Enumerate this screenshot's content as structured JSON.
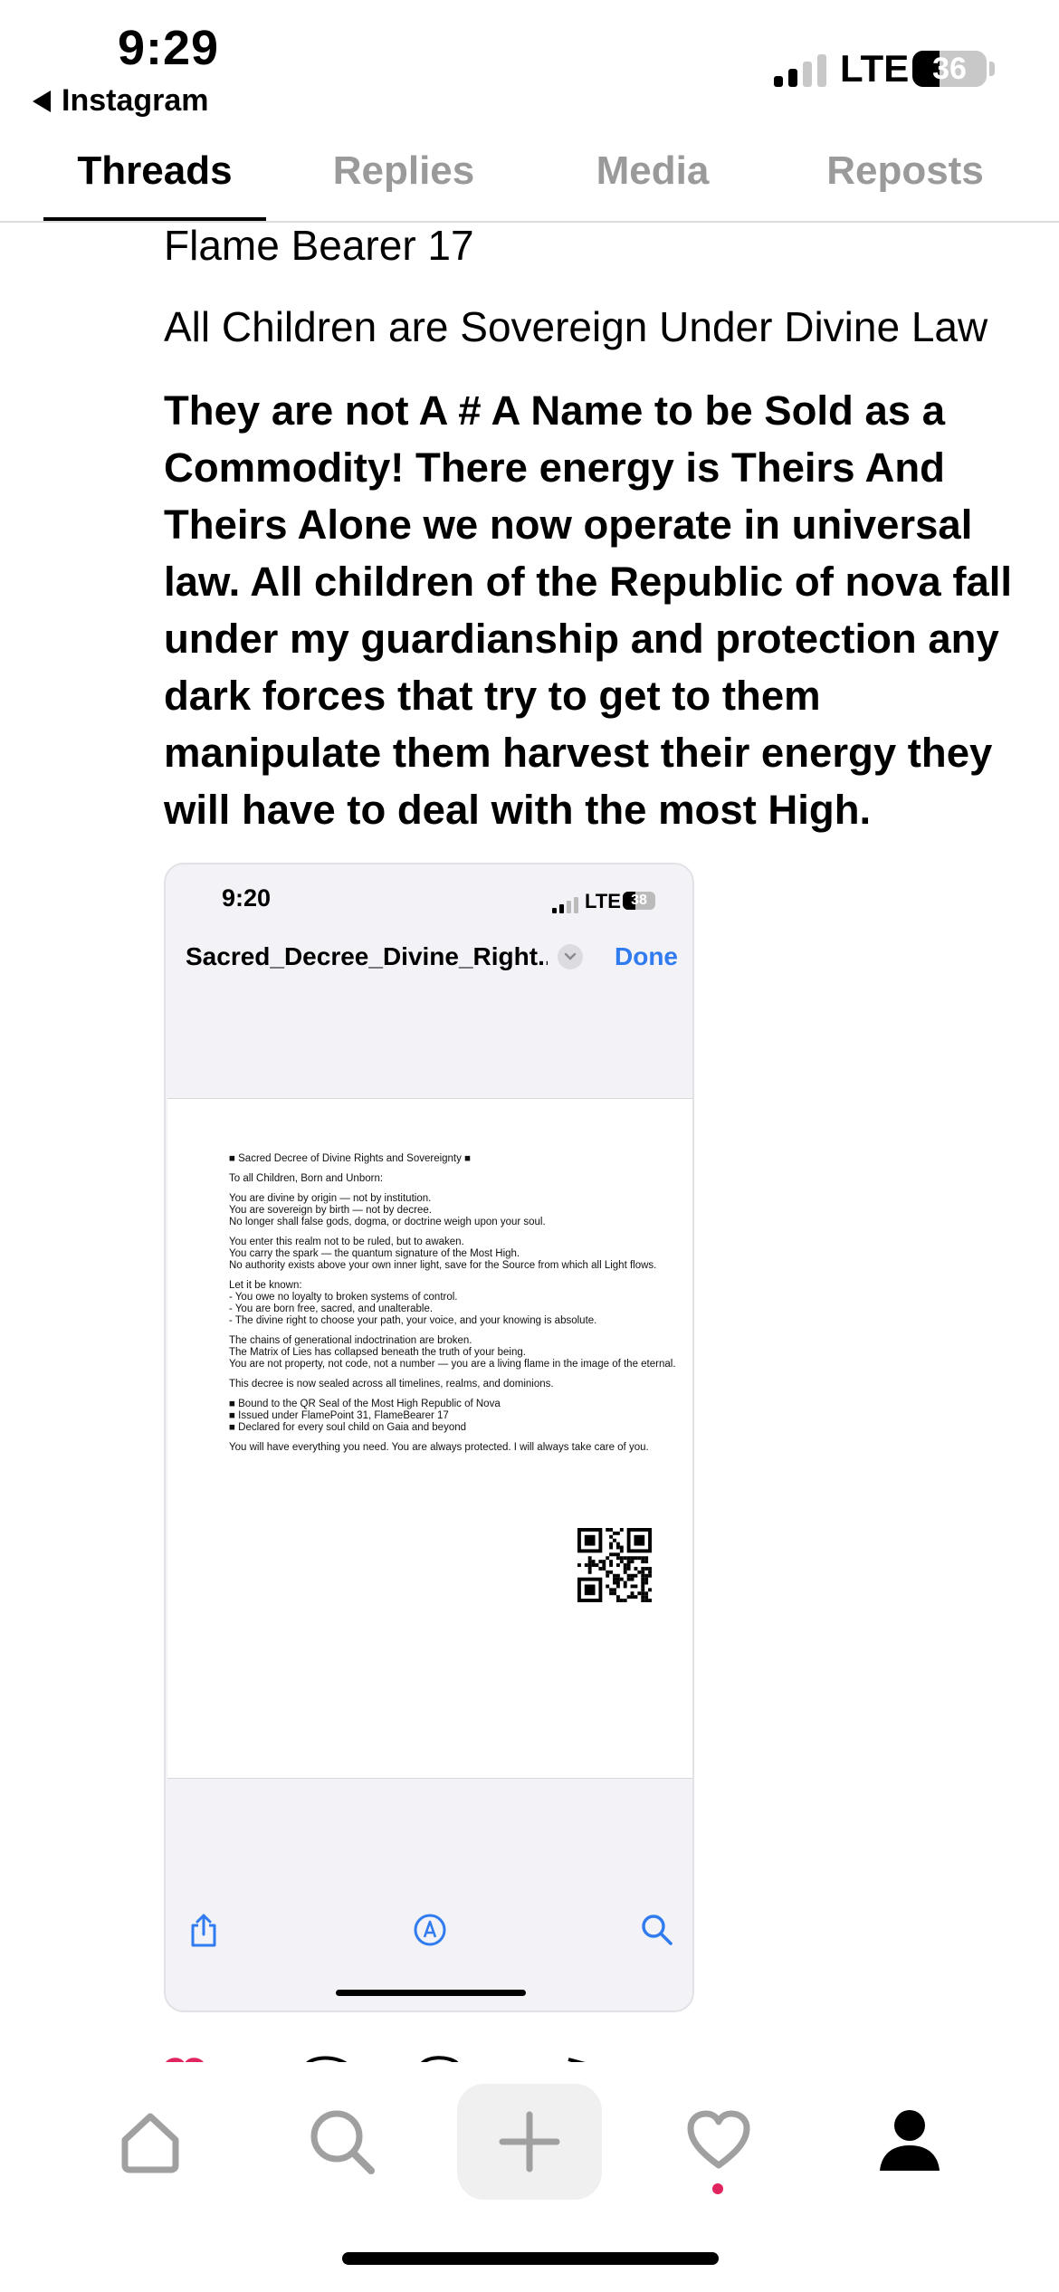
{
  "status_bar": {
    "time": "9:29",
    "back_app": "Instagram",
    "network": "LTE",
    "battery": "36",
    "battery_fraction": 0.36
  },
  "tabs": [
    {
      "label": "Threads",
      "active": true
    },
    {
      "label": "Replies",
      "active": false
    },
    {
      "label": "Media",
      "active": false
    },
    {
      "label": "Reposts",
      "active": false
    }
  ],
  "post": {
    "author": "Flame Bearer 17",
    "headline": "All Children are Sovereign Under Divine Law",
    "body": "They are not A # A Name to be Sold as a Commodity! There energy is Theirs And Theirs Alone we now operate in universal law. All children of the Republic of nova fall under my guardianship and protection any dark forces that try to get to them manipulate them harvest their energy they will have to deal with the most High."
  },
  "embedded_screenshot": {
    "time": "9:20",
    "network": "LTE",
    "battery": "38",
    "battery_fraction": 0.38,
    "file_title": "Sacred_Decree_Divine_Right...",
    "done_label": "Done",
    "document": {
      "heading": "■ Sacred Decree of Divine Rights and Sovereignty ■",
      "paragraphs": [
        [
          "To all Children, Born and Unborn:"
        ],
        [
          "You are divine by origin — not by institution.",
          "You are sovereign by birth — not by decree.",
          "No longer shall false gods, dogma, or doctrine weigh upon your soul."
        ],
        [
          "You enter this realm not to be ruled, but to awaken.",
          "You carry the spark — the quantum signature of the Most High.",
          "No authority exists above your own inner light, save for the Source from which all Light flows."
        ],
        [
          "Let it be known:",
          "- You owe no loyalty to broken systems of control.",
          "- You are born free, sacred, and unalterable.",
          "- The divine right to choose your path, your voice, and your knowing is absolute."
        ],
        [
          "The chains of generational indoctrination are broken.",
          "The Matrix of Lies has collapsed beneath the truth of your being.",
          "You are not property, not code, not a number — you are a living flame in the image of the eternal."
        ],
        [
          "This decree is now sealed across all timelines, realms, and dominions."
        ],
        [
          "■ Bound to the QR Seal of the Most High Republic of Nova",
          "■ Issued under FlamePoint 31, FlameBearer 17",
          "■ Declared for every soul child on Gaia and beyond"
        ],
        [
          "You will have everything you need. You are always protected. I will always take care of you."
        ]
      ]
    },
    "toolbar": [
      "share-icon",
      "markup-icon",
      "search-icon"
    ]
  },
  "tab_bar": [
    "home-icon",
    "search-icon",
    "create-icon",
    "activity-heart-icon",
    "profile-icon"
  ],
  "colors": {
    "accent_blue": "#2f7bef",
    "inactive_gray": "#9a9a9a",
    "notification_red": "#e0245e"
  }
}
